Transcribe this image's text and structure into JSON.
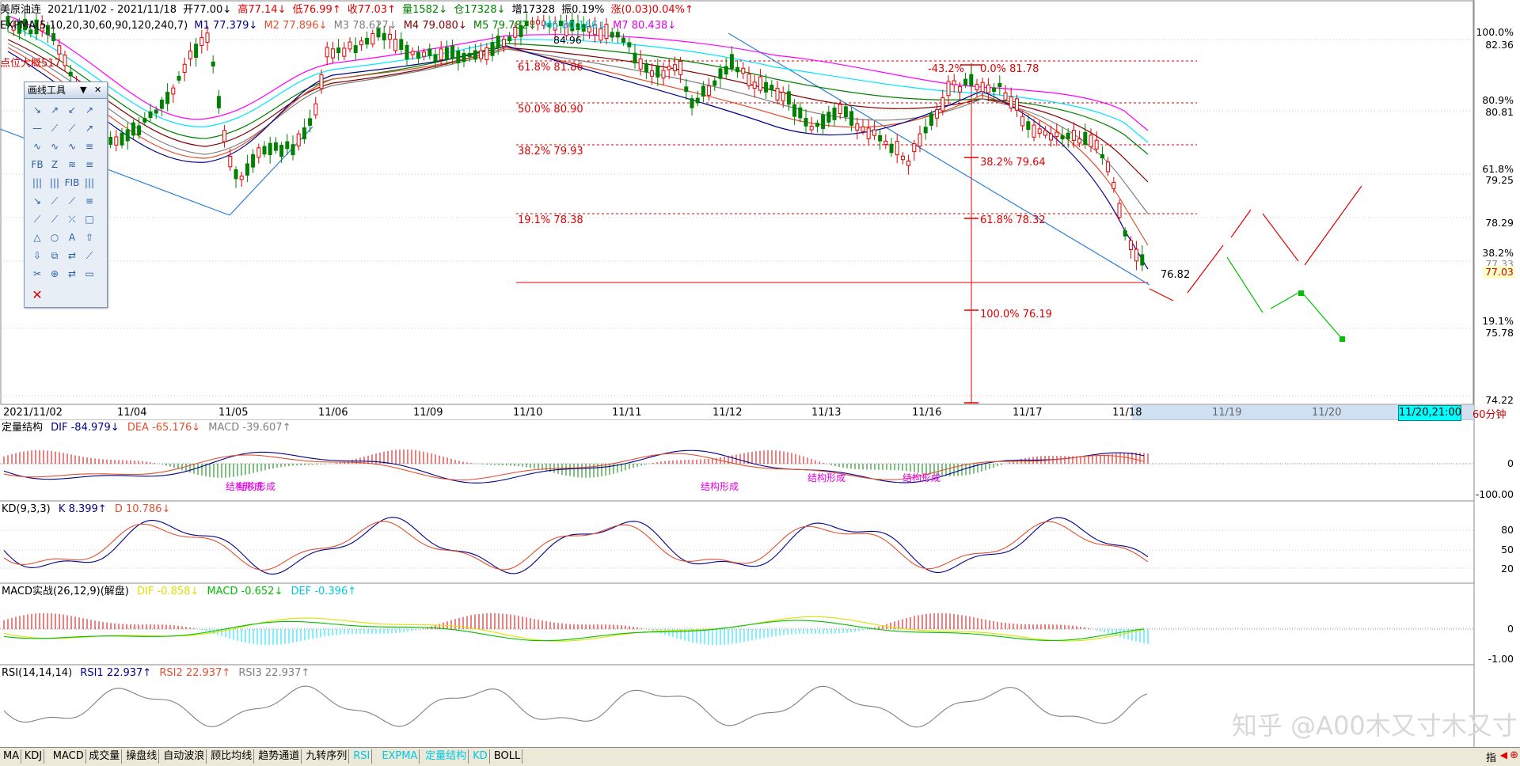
{
  "header": {
    "symbol": "美原油连",
    "date_range": "2021/11/02 - 2021/11/18",
    "open": "开77.00↓",
    "high": "高77.14↓",
    "low": "低76.99↑",
    "close": "收77.03↑",
    "volume": "量1582↓",
    "oi": "仓17328↓",
    "oi_inc": "增17328",
    "amplitude": "振0.19%",
    "change": "涨(0.03)0.04%↑"
  },
  "expma": {
    "name": "EXPMA(5,10,20,30,60,90,120,240,7)",
    "m1": "M1 77.379↓",
    "m2": "M2 77.896↓",
    "m3": "M3 78.627↓",
    "m4": "M4 79.080↓",
    "m5": "M5 79.782↓",
    "m6": "M6 80.166↓",
    "m7": "M7 80.438↓"
  },
  "annotations": {
    "left_note": "点位大概517",
    "peak_label": "84.96",
    "low_label": "76.82",
    "fib_left": [
      "61.8% 81.86",
      "50.0% 80.90",
      "38.2% 79.93",
      "19.1% 78.38"
    ],
    "fib_right": [
      "-43.2%",
      "0.0% 81.78",
      "38.2% 79.64",
      "61.8% 78.32",
      "100.0% 76.19"
    ]
  },
  "right_axis": {
    "prices": [
      "82.36",
      "80.81",
      "79.25",
      "78.29",
      "77.33",
      "75.78",
      "74.22"
    ],
    "pcts": [
      "100.0%",
      "80.9%",
      "61.8%",
      "38.2%",
      "19.1%"
    ],
    "last_price": "77.03"
  },
  "x_axis": {
    "dates": [
      "2021/11/02",
      "11/04",
      "11/05",
      "11/06",
      "11/09",
      "11/10",
      "11/11",
      "11/12",
      "11/13",
      "11/16",
      "11/17",
      "11/18",
      "11/19",
      "11/20"
    ],
    "cursor_date": "11/20,21:00",
    "period": "60分钟"
  },
  "toolbox": {
    "title": "画线工具",
    "tools": [
      "↘",
      "↗",
      "↙",
      "↗",
      "—",
      "⟋",
      "⟋",
      "↗",
      "∿",
      "∿",
      "∿",
      "≡",
      "FB",
      "Z",
      "≋",
      "≡",
      "|||",
      "|||",
      "FIB",
      "|||",
      "↘",
      "⟋",
      "⟋",
      "≡",
      "⟋",
      "⟋",
      "⤫",
      "□",
      "△",
      "○",
      "A",
      "⇧",
      "⇩",
      "⧉",
      "⇄",
      "⟋",
      "✂",
      "⊕",
      "⇄",
      "▭"
    ],
    "close_icon": "✕"
  },
  "macd_panel": {
    "name": "定量结构",
    "dif": "DIF -84.979↓",
    "dea": "DEA -65.176↓",
    "macd": "MACD -39.607↑",
    "scale": [
      "0",
      "-100.00"
    ],
    "labels": [
      "结构形成",
      "结构形成",
      "结构形成",
      "结构形成",
      "结构形成"
    ]
  },
  "kd_panel": {
    "name": "KD(9,3,3)",
    "k": "K 8.399↑",
    "d": "D 10.786↓",
    "scale": [
      "80",
      "50",
      "20"
    ]
  },
  "macd2_panel": {
    "name": "MACD实战(26,12,9)(解盘)",
    "dif": "DIF -0.858↓",
    "macd": "MACD -0.652↓",
    "def": "DEF -0.396↑",
    "scale": [
      "0",
      "-1.00"
    ]
  },
  "rsi_panel": {
    "name": "RSI(14,14,14)",
    "rsi1": "RSI1 22.937↑",
    "rsi2": "RSI2 22.937↑",
    "rsi3": "RSI3 22.937↑"
  },
  "bottom_tabs": [
    "MA",
    "KDJ",
    "MACD",
    "成交量",
    "操盘线",
    "自动波浪",
    "顾比均线",
    "趋势通道",
    "九转序列",
    "RSI",
    "EXPMA",
    "定量结构",
    "KD",
    "BOLL"
  ],
  "bottom_right": "指",
  "watermark": "知乎 @A00木又寸木又寸",
  "colors": {
    "up": "#e00000",
    "down": "#008000",
    "accent": "#00c8e6"
  }
}
